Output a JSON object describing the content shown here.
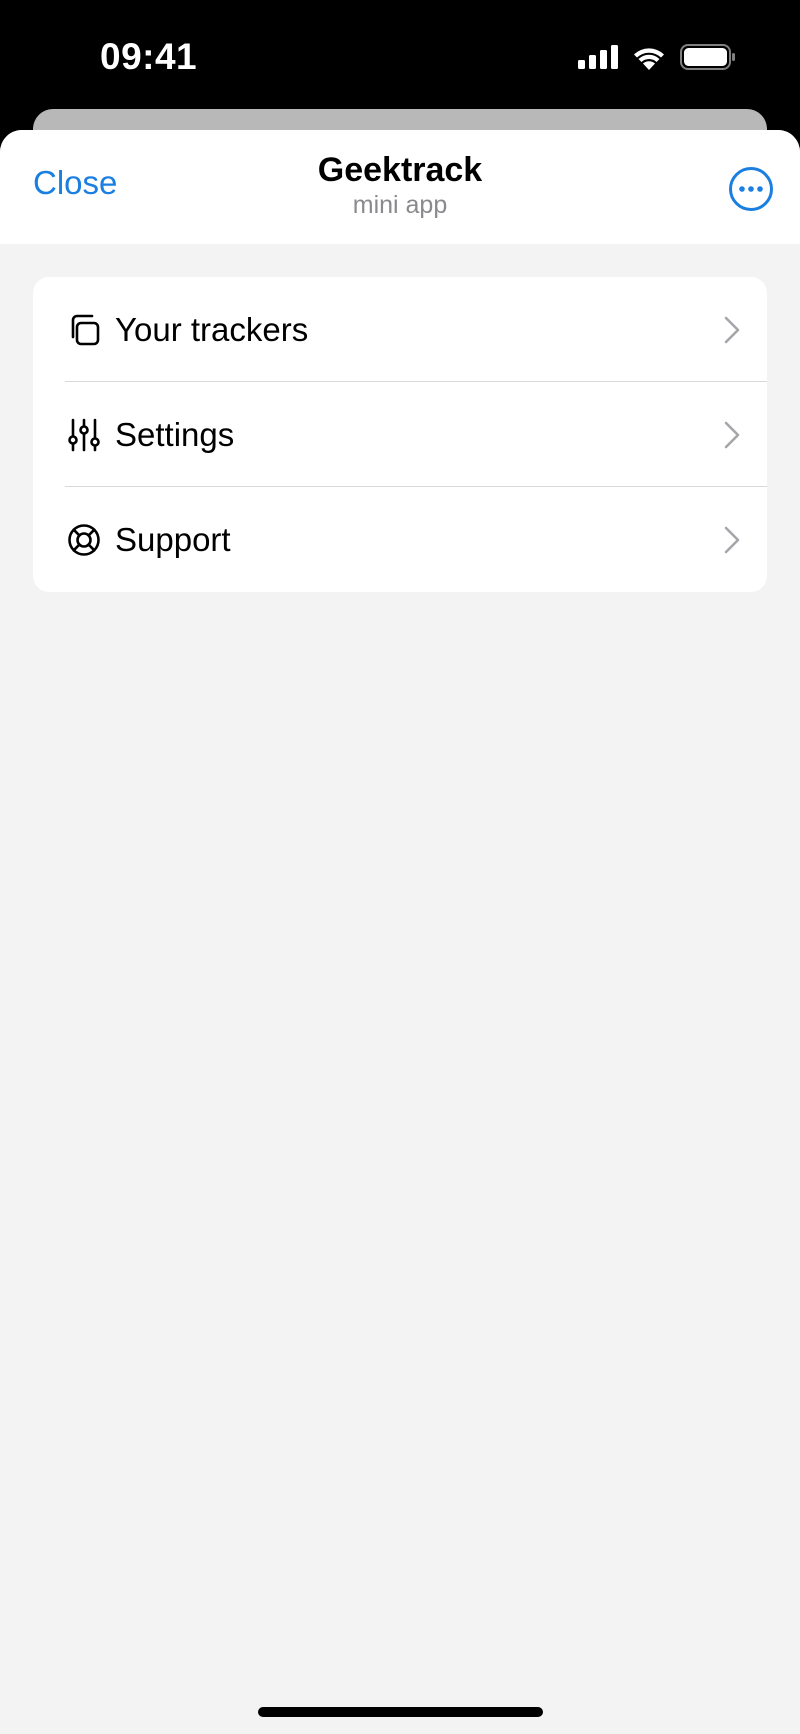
{
  "status_bar": {
    "time": "09:41",
    "icons": [
      "cellular-signal-icon",
      "wifi-icon",
      "battery-icon"
    ]
  },
  "header": {
    "close_label": "Close",
    "title": "Geektrack",
    "subtitle": "mini app",
    "more_icon": "more-ellipsis-icon"
  },
  "menu": {
    "items": [
      {
        "label": "Your trackers",
        "icon": "copy-squares-icon"
      },
      {
        "label": "Settings",
        "icon": "sliders-icon"
      },
      {
        "label": "Support",
        "icon": "lifebuoy-icon"
      }
    ]
  },
  "colors": {
    "accent": "#1a7fe0",
    "background": "#f3f3f3",
    "card": "#ffffff",
    "secondary_text": "#8a8a8e",
    "chevron": "#a5a5aa"
  }
}
